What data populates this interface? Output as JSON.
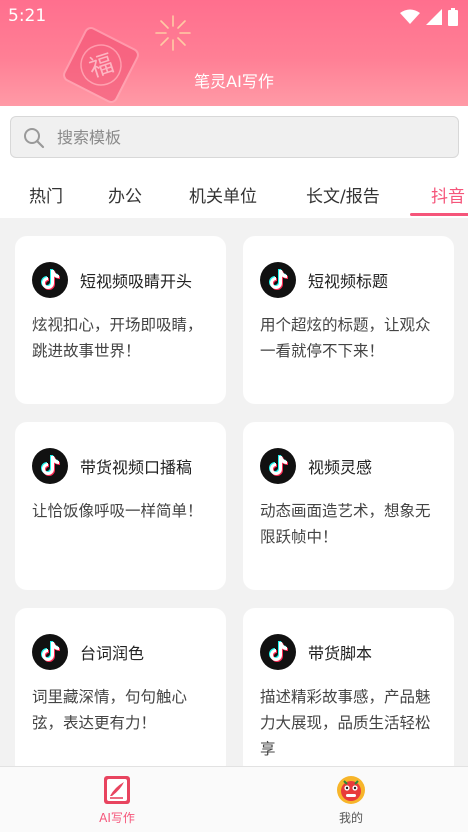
{
  "status_bar": {
    "time": "5:21"
  },
  "header": {
    "app_title": "笔灵AI写作"
  },
  "search": {
    "placeholder": "搜索模板"
  },
  "tabs": [
    {
      "label": "热门"
    },
    {
      "label": "办公"
    },
    {
      "label": "机关单位"
    },
    {
      "label": "长文/报告"
    },
    {
      "label": "抖音"
    }
  ],
  "cards": [
    {
      "icon": "tiktok-icon",
      "title": "短视频吸睛开头",
      "desc": "炫视扣心，开场即吸睛，跳进故事世界！"
    },
    {
      "icon": "tiktok-icon",
      "title": "短视频标题",
      "desc": "用个超炫的标题，让观众一看就停不下来！"
    },
    {
      "icon": "tiktok-icon",
      "title": "带货视频口播稿",
      "desc": "让恰饭像呼吸一样简单！"
    },
    {
      "icon": "tiktok-icon",
      "title": "视频灵感",
      "desc": "动态画面造艺术，想象无限跃帧中！"
    },
    {
      "icon": "tiktok-icon",
      "title": "台词润色",
      "desc": "词里藏深情，句句触心弦，表达更有力！"
    },
    {
      "icon": "tiktok-icon",
      "title": "带货脚本",
      "desc": "描述精彩故事感，产品魅力大展现，品质生活轻松享"
    }
  ],
  "bottom_nav": {
    "items": [
      {
        "label": "AI写作",
        "icon": "pen-book-icon",
        "active": true
      },
      {
        "label": "我的",
        "icon": "lion-avatar-icon",
        "active": false
      }
    ]
  },
  "colors": {
    "accent": "#f5557a",
    "header": "#ff7f95",
    "background": "#f2f2f2"
  },
  "header_deco": {
    "fu_char": "福"
  }
}
